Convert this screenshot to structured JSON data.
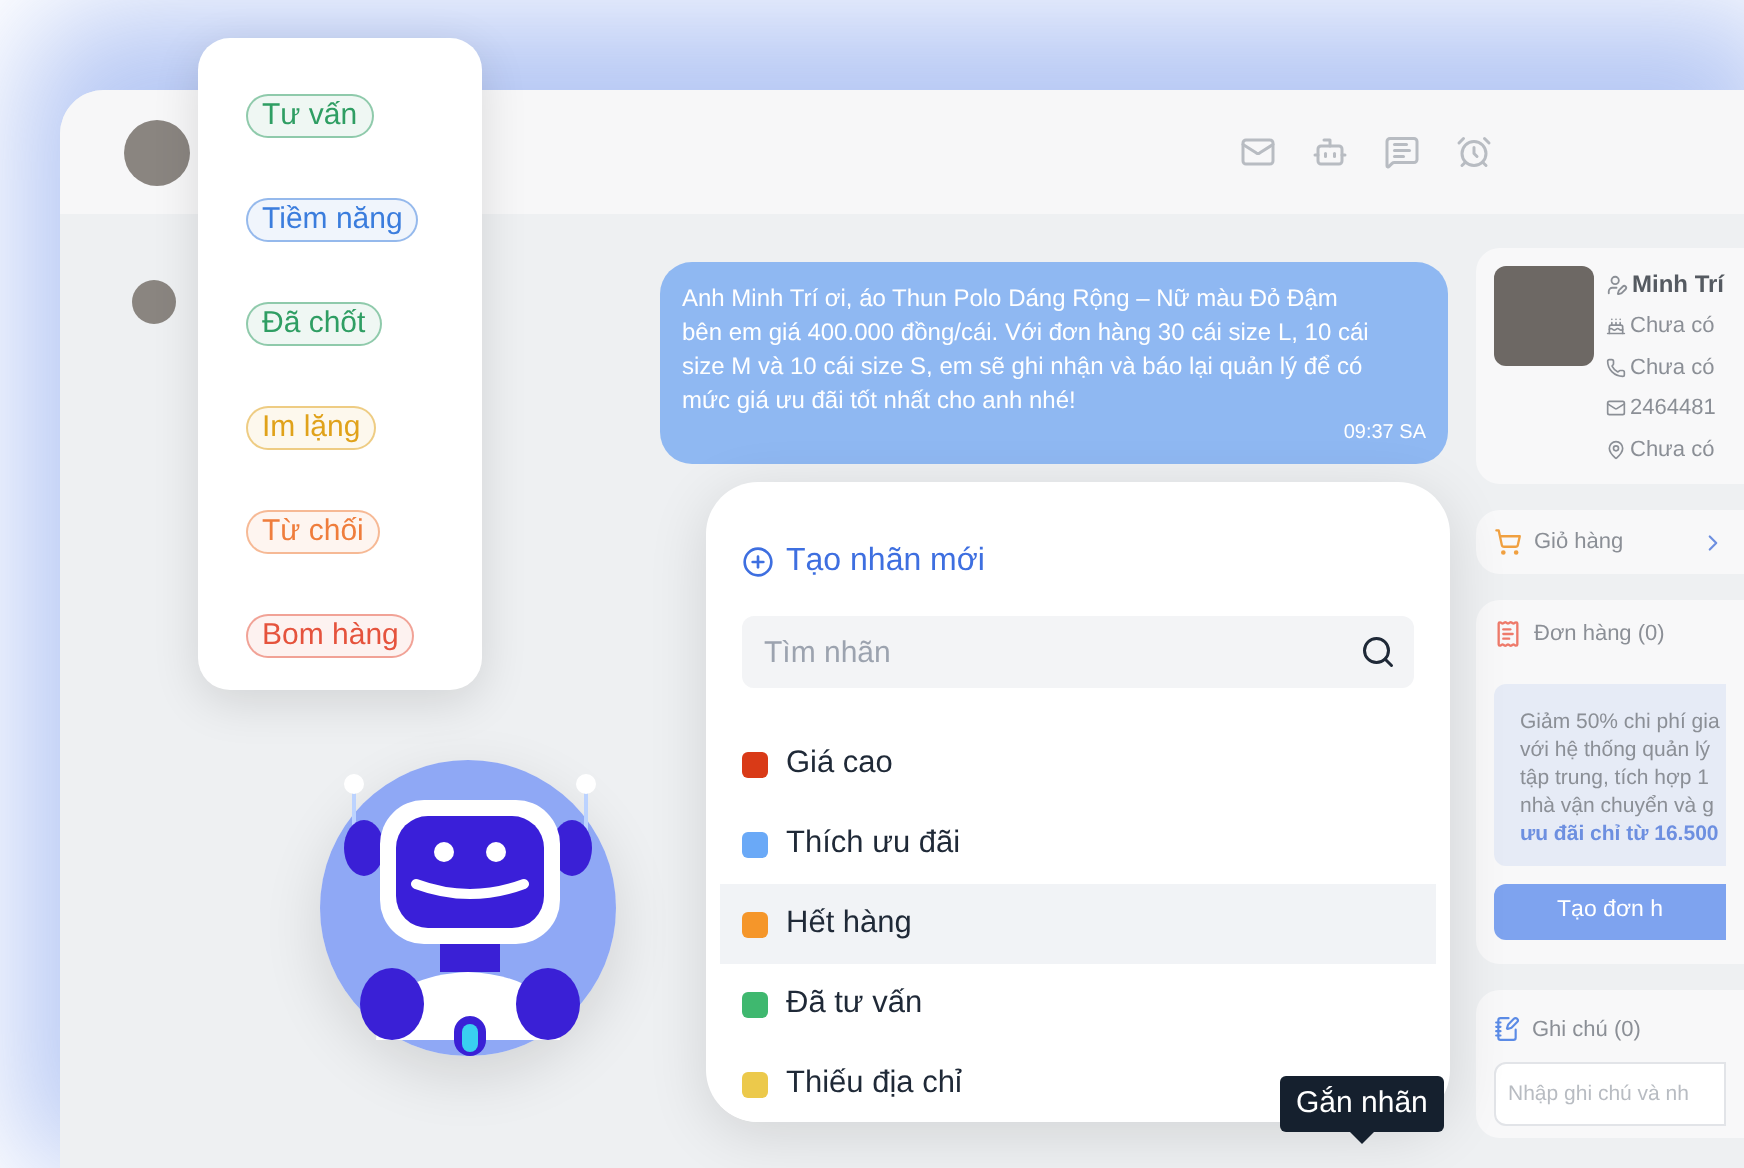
{
  "chat": {
    "message": {
      "text": "Anh Minh Trí ơi, áo Thun Polo Dáng Rộng – Nữ màu Đỏ Đậm bên em giá 400.000 đồng/cái. Với đơn hàng 30 cái size L, 10 cái size M và 10 cái size S, em sẽ ghi nhận và báo lại quản lý để có mức giá ưu đãi tốt nhất cho anh nhé!",
      "time": "09:37 SA"
    }
  },
  "customer": {
    "name": "Minh Trí",
    "details": [
      {
        "kind": "birthday",
        "text": "Chưa có"
      },
      {
        "kind": "phone",
        "text": "Chưa có"
      },
      {
        "kind": "email",
        "text": "2464481"
      },
      {
        "kind": "address",
        "text": "Chưa có"
      }
    ]
  },
  "cart": {
    "title": "Giỏ hàng"
  },
  "orders": {
    "title": "Đơn hàng (0)",
    "promo_lines": [
      "Giảm 50% chi phí gia",
      "với hệ thống quản lý",
      "tập trung, tích hợp 1",
      "nhà vận chuyển và g"
    ],
    "promo_highlight": "ưu đãi chỉ từ 16.500",
    "button": "Tạo đơn h"
  },
  "notes": {
    "title": "Ghi chú (0)",
    "placeholder": "Nhập ghi chú và nh"
  },
  "status_tags": [
    {
      "label": "Tư vấn",
      "color": "#2f9e63"
    },
    {
      "label": "Tiềm năng",
      "color": "#3b7ddd"
    },
    {
      "label": "Đã chốt",
      "color": "#2f9e63"
    },
    {
      "label": "Im lặng",
      "color": "#e0a21a"
    },
    {
      "label": "Từ chối",
      "color": "#ef7d3c"
    },
    {
      "label": "Bom hàng",
      "color": "#e5533d"
    }
  ],
  "label_menu": {
    "create": "Tạo nhãn mới",
    "search_placeholder": "Tìm nhãn",
    "labels": [
      {
        "label": "Giá cao",
        "color": "#d93a17",
        "highlighted": false
      },
      {
        "label": "Thích ưu đãi",
        "color": "#6aa9f7",
        "highlighted": false
      },
      {
        "label": "Hết hàng",
        "color": "#f5962a",
        "highlighted": true
      },
      {
        "label": "Đã tư vấn",
        "color": "#3fb86f",
        "highlighted": false
      },
      {
        "label": "Thiếu địa chỉ",
        "color": "#ecc94b",
        "highlighted": false
      }
    ]
  },
  "tooltip": "Gắn nhãn"
}
